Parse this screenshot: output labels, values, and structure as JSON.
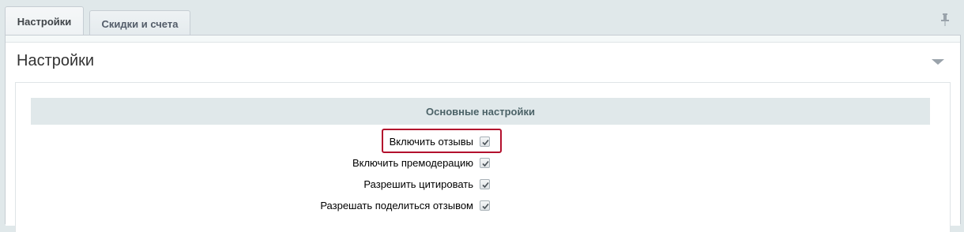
{
  "tabs": [
    {
      "label": "Настройки",
      "active": true
    },
    {
      "label": "Скидки и счета",
      "active": false
    }
  ],
  "pin_icon": "pin-icon",
  "section": {
    "title": "Настройки",
    "collapse_icon": "chevron-down-icon"
  },
  "settings": {
    "header": "Основные настройки",
    "items": [
      {
        "label": "Включить отзывы",
        "checked": true,
        "highlighted": true
      },
      {
        "label": "Включить премодерацию",
        "checked": true,
        "highlighted": false
      },
      {
        "label": "Разрешить цитировать",
        "checked": true,
        "highlighted": false
      },
      {
        "label": "Разрешать поделиться отзывом",
        "checked": true,
        "highlighted": false
      }
    ]
  },
  "colors": {
    "highlight": "#b3102d",
    "header_bg": "#e0e8ea"
  }
}
